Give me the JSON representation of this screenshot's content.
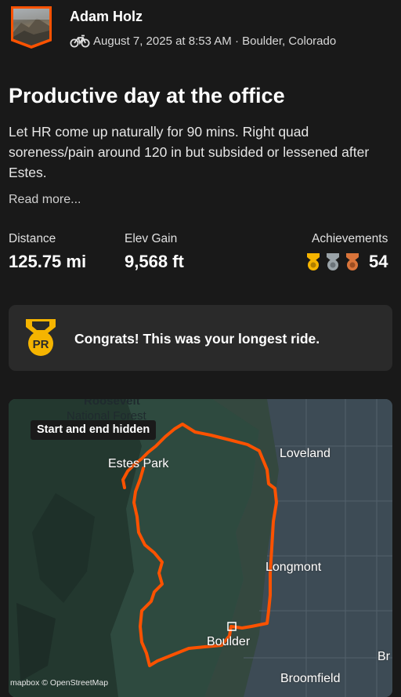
{
  "athlete": {
    "name": "Adam Holz"
  },
  "activity": {
    "sport_icon": "bike-icon",
    "meta": "August 7, 2025 at 8:53 AM · Boulder, Colorado",
    "title": "Productive day at the office",
    "description": "Let HR come up naturally for 90 mins. Right quad soreness/pain around 120 in but subsided or lessened after Estes.",
    "read_more": "Read more..."
  },
  "stats": {
    "distance_label": "Distance",
    "distance_value": "125.75 mi",
    "elev_label": "Elev Gain",
    "elev_value": "9,568 ft",
    "achievements_label": "Achievements",
    "achievements_count": "54",
    "medal_colors": [
      "#f5b400",
      "#9aa3a8",
      "#d9743a"
    ]
  },
  "pr_card": {
    "badge_text": "PR",
    "badge_color": "#f5b400",
    "message": "Congrats! This was your longest ride."
  },
  "map": {
    "privacy_chip": "Start and end hidden",
    "labels": {
      "forest_line1": "Roosevelt",
      "forest_line2": "National Forest",
      "estes_park": "Estes Park",
      "loveland": "Loveland",
      "longmont": "Longmont",
      "boulder": "Boulder",
      "broomfield": "Broomfield",
      "br": "Br"
    },
    "attribution": "mapbox © OpenStreetMap",
    "route_color": "#fc5200"
  }
}
